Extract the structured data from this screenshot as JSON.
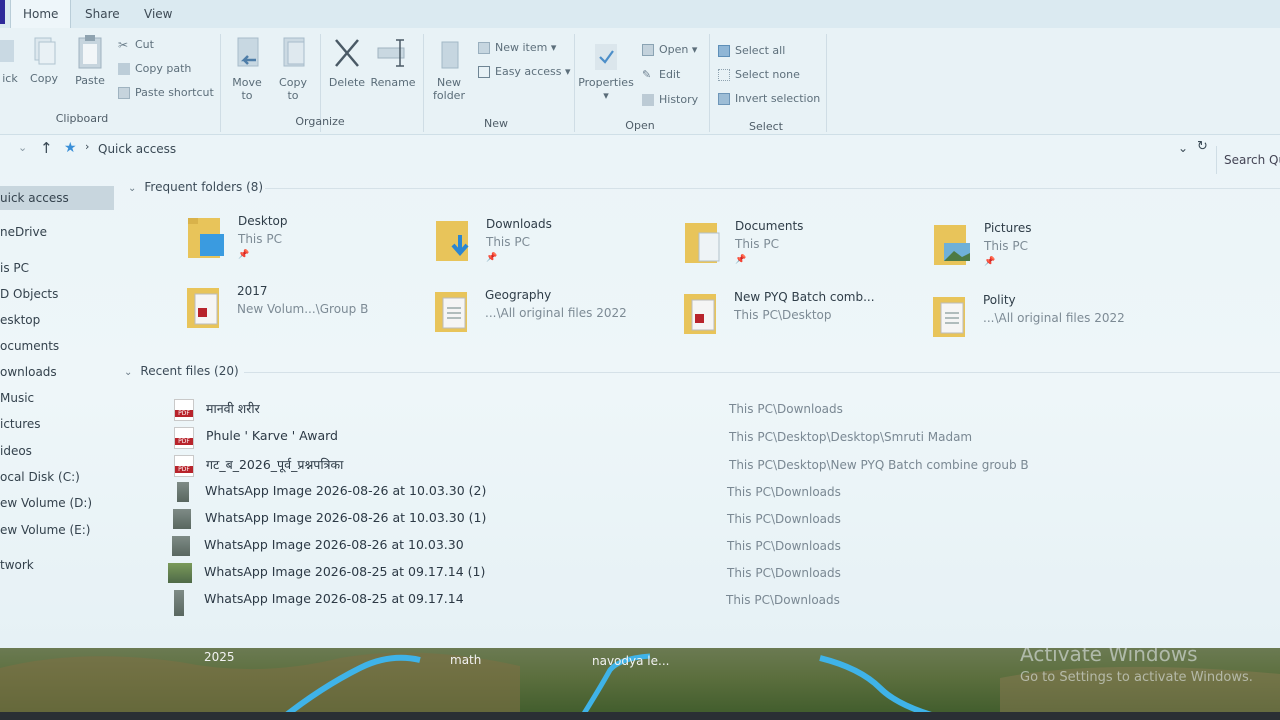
{
  "tabs": [
    {
      "label": "Home"
    },
    {
      "label": "Share"
    },
    {
      "label": "View"
    }
  ],
  "ribbon": {
    "clipboard": {
      "pin_label": "ick",
      "copy_label": "Copy",
      "paste_label": "Paste",
      "cut_label": "Cut",
      "copy_path_label": "Copy path",
      "paste_shortcut_label": "Paste shortcut",
      "group_label": "Clipboard"
    },
    "organize": {
      "move_to_label": "Move to",
      "copy_to_label": "Copy to",
      "delete_label": "Delete",
      "rename_label": "Rename",
      "group_label": "Organize"
    },
    "new": {
      "new_folder_label": "New folder",
      "new_item_label": "New item",
      "easy_access_label": "Easy access",
      "group_label": "New"
    },
    "open": {
      "properties_label": "Properties",
      "open_label": "Open",
      "edit_label": "Edit",
      "history_label": "History",
      "group_label": "Open"
    },
    "select": {
      "select_all_label": "Select all",
      "select_none_label": "Select none",
      "invert_selection_label": "Invert selection",
      "group_label": "Select"
    }
  },
  "address": {
    "path": "Quick access",
    "search_placeholder": "Search Qu"
  },
  "nav": {
    "items": [
      {
        "label": "uick access",
        "selected": true
      },
      {
        "label": "neDrive"
      },
      {
        "label": "is PC"
      },
      {
        "label": "D Objects"
      },
      {
        "label": "esktop"
      },
      {
        "label": "ocuments"
      },
      {
        "label": "ownloads"
      },
      {
        "label": "Music"
      },
      {
        "label": "ictures"
      },
      {
        "label": "ideos"
      },
      {
        "label": "ocal Disk (C:)"
      },
      {
        "label": "ew Volume (D:)"
      },
      {
        "label": "ew Volume (E:)"
      },
      {
        "label": "twork"
      }
    ]
  },
  "frequent": {
    "header": "Frequent folders (8)",
    "folders": [
      {
        "name": "Desktop",
        "path": "This PC",
        "pinned": true,
        "icon": "desktop-folder"
      },
      {
        "name": "Downloads",
        "path": "This PC",
        "pinned": true,
        "icon": "downloads-folder"
      },
      {
        "name": "Documents",
        "path": "This PC",
        "pinned": true,
        "icon": "documents-folder"
      },
      {
        "name": "Pictures",
        "path": "This PC",
        "pinned": true,
        "icon": "pictures-folder"
      },
      {
        "name": "2017",
        "path": "New Volum...\\Group B",
        "icon": "pdf-folder"
      },
      {
        "name": "Geography",
        "path": "...\\All original files 2022",
        "icon": "docs-folder"
      },
      {
        "name": "New PYQ Batch comb...",
        "path": "This PC\\Desktop",
        "icon": "pdf-folder"
      },
      {
        "name": "Polity",
        "path": "...\\All original files 2022",
        "icon": "docs-folder"
      }
    ]
  },
  "recent": {
    "header": "Recent files (20)",
    "files": [
      {
        "name": "मानवी शरीर",
        "location": "This PC\\Downloads",
        "type": "pdf"
      },
      {
        "name": "Phule ' Karve ' Award",
        "location": "This PC\\Desktop\\Desktop\\Smruti Madam",
        "type": "pdf"
      },
      {
        "name": "गट_ब_2026_पूर्व_प्रश्नपत्रिका",
        "location": "This PC\\Desktop\\New PYQ Batch combine groub B",
        "type": "pdf"
      },
      {
        "name": "WhatsApp Image 2026-08-26 at 10.03.30 (2)",
        "location": "This PC\\Downloads",
        "type": "image"
      },
      {
        "name": "WhatsApp Image 2026-08-26 at 10.03.30 (1)",
        "location": "This PC\\Downloads",
        "type": "image"
      },
      {
        "name": "WhatsApp Image 2026-08-26 at 10.03.30",
        "location": "This PC\\Downloads",
        "type": "image"
      },
      {
        "name": "WhatsApp Image 2026-08-25 at 09.17.14 (1)",
        "location": "This PC\\Downloads",
        "type": "image-green"
      },
      {
        "name": "WhatsApp Image 2026-08-25 at 09.17.14",
        "location": "This PC\\Downloads",
        "type": "image"
      }
    ]
  },
  "desktop": {
    "icons": [
      {
        "label": "2025"
      },
      {
        "label": "math"
      },
      {
        "label": "navodya le..."
      }
    ],
    "watermark_title": "Activate Windows",
    "watermark_sub": "Go to Settings to activate Windows."
  },
  "colors": {
    "pdf_red": "#b8232b",
    "folder_yellow": "#e8c45a",
    "accent_blue": "#3a8fd8"
  }
}
